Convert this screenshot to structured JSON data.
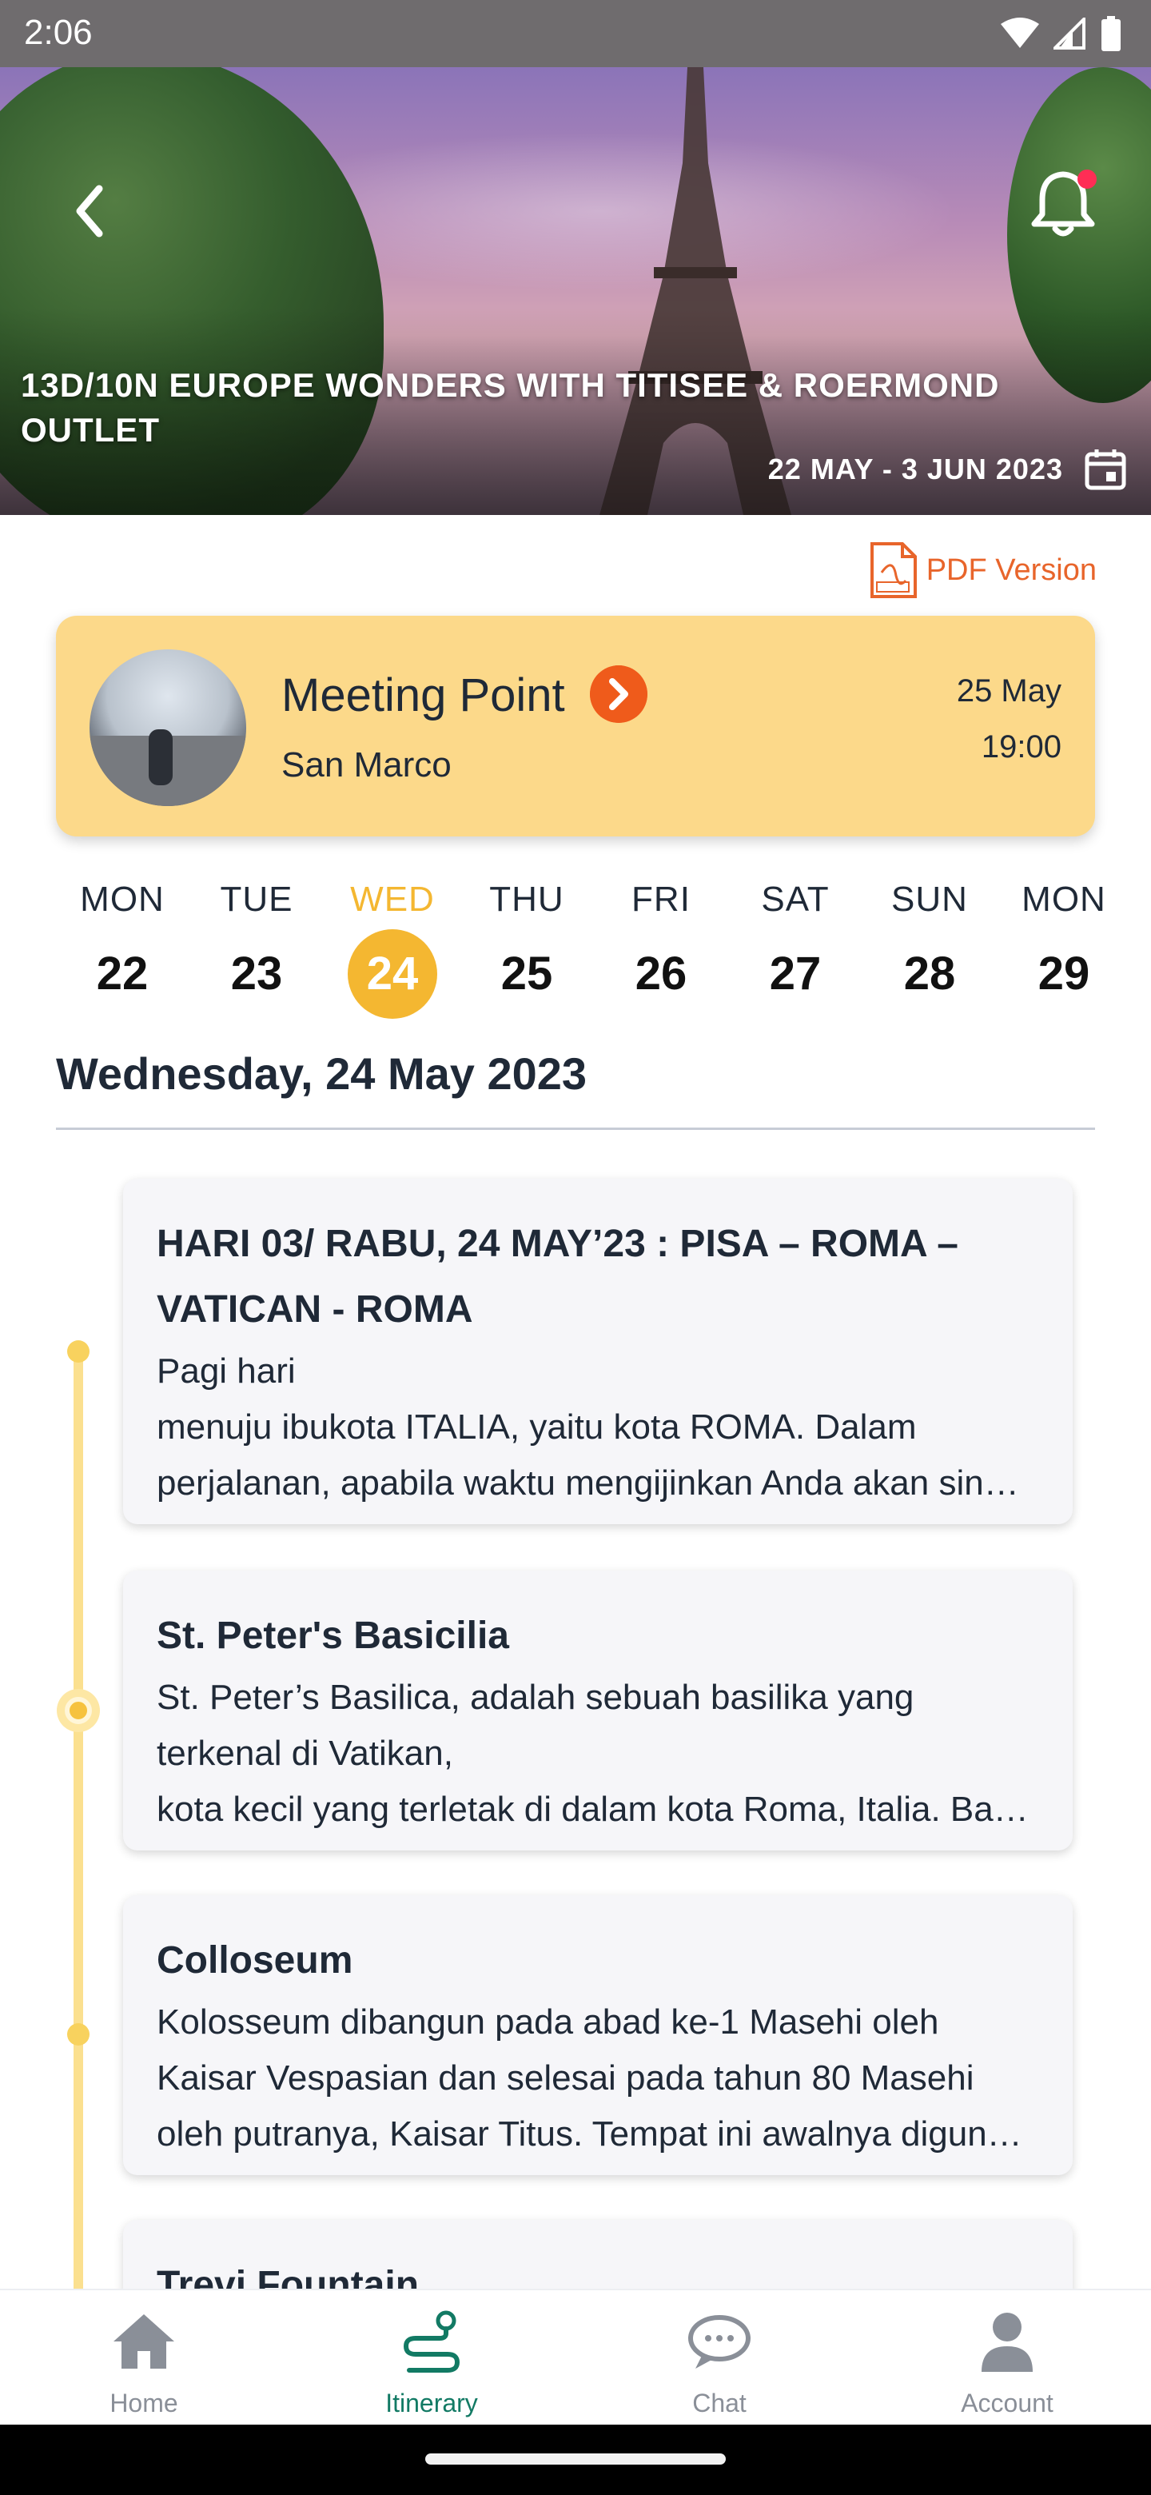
{
  "status_bar": {
    "time": "2:06"
  },
  "hero": {
    "title": "13D/10N EUROPE WONDERS WITH TITISEE & ROERMOND OUTLET",
    "dates": "22 MAY - 3 JUN 2023"
  },
  "pdf": {
    "label": "PDF Version"
  },
  "meeting": {
    "title": "Meeting Point",
    "location": "San Marco",
    "date": "25 May",
    "time": "19:00"
  },
  "days": [
    {
      "name": "MON",
      "num": "22"
    },
    {
      "name": "TUE",
      "num": "23"
    },
    {
      "name": "WED",
      "num": "24",
      "active": true
    },
    {
      "name": "THU",
      "num": "25"
    },
    {
      "name": "FRI",
      "num": "26"
    },
    {
      "name": "SAT",
      "num": "27"
    },
    {
      "name": "SUN",
      "num": "28"
    },
    {
      "name": "MON",
      "num": "29"
    }
  ],
  "selected_date_heading": "Wednesday, 24 May 2023",
  "cards": [
    {
      "title_lines": [
        "HARI 03/ RABU, 24 MAY’23 : PISA – ROMA –",
        "VATICAN - ROMA"
      ],
      "lines": [
        "Pagi hari",
        "menuju ibukota ITALIA, yaitu kota ROMA. Dalam",
        "perjalanan, apabila waktu mengijinkan Anda akan sin…"
      ]
    },
    {
      "title_lines": [
        "St. Peter's Basicilia"
      ],
      "lines": [
        "St. Peter’s Basilica, adalah sebuah basilika yang",
        "terkenal di Vatikan,",
        "kota kecil yang terletak di dalam kota Roma, Italia. Ba…"
      ]
    },
    {
      "title_lines": [
        "Colloseum"
      ],
      "lines": [
        "Kolosseum dibangun pada abad ke-1 Masehi oleh",
        "Kaisar Vespasian dan selesai pada tahun 80 Masehi",
        "oleh putranya, Kaisar Titus. Tempat ini awalnya digun…"
      ]
    },
    {
      "title_lines": [
        "Trevi Fountain"
      ],
      "lines": []
    }
  ],
  "bottom_nav": [
    {
      "label": "Home",
      "icon": "home-icon"
    },
    {
      "label": "Itinerary",
      "icon": "itinerary-icon",
      "active": true
    },
    {
      "label": "Chat",
      "icon": "chat-icon"
    },
    {
      "label": "Account",
      "icon": "account-icon"
    }
  ],
  "colors": {
    "accent_yellow": "#f4b731",
    "meeting_card": "#fcd98a",
    "active_nav": "#127a64",
    "pdf_orange": "#e8652b"
  }
}
